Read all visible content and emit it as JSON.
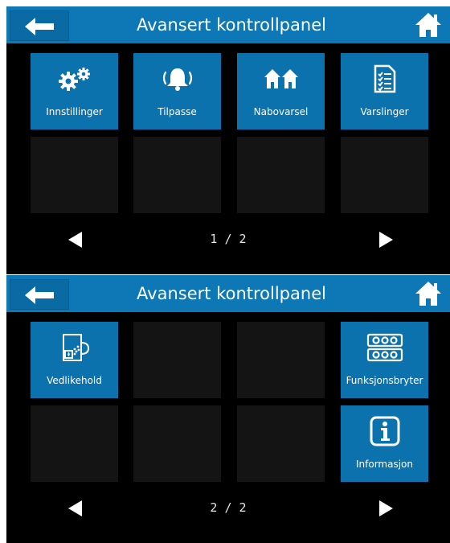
{
  "theme": {
    "accent": "#0b72ad",
    "header": "#0d78b5",
    "background": "#000000",
    "empty_tile": "#141414",
    "text": "#ffffff"
  },
  "screens": [
    {
      "title": "Avansert kontrollpanel",
      "back_icon": "arrow-left-icon",
      "home_icon": "home-icon",
      "tiles": [
        {
          "label": "Innstillinger",
          "icon": "gears-icon"
        },
        {
          "label": "Tilpasse",
          "icon": "bell-icon"
        },
        {
          "label": "Nabovarsel",
          "icon": "houses-icon"
        },
        {
          "label": "Varslinger",
          "icon": "checklist-icon"
        }
      ],
      "prev_icon": "triangle-left-icon",
      "next_icon": "triangle-right-icon",
      "page_indicator": "1 / 2"
    },
    {
      "title": "Avansert kontrollpanel",
      "back_icon": "arrow-left-icon",
      "home_icon": "home-icon",
      "tiles": [
        {
          "label": "Vedlikehold",
          "icon": "maintenance-icon"
        },
        {
          "label": "Funksjonsbryter",
          "icon": "switch-panel-icon"
        },
        {
          "label": "Informasjon",
          "icon": "info-icon"
        }
      ],
      "prev_icon": "triangle-left-icon",
      "next_icon": "triangle-right-icon",
      "page_indicator": "2 / 2"
    }
  ]
}
